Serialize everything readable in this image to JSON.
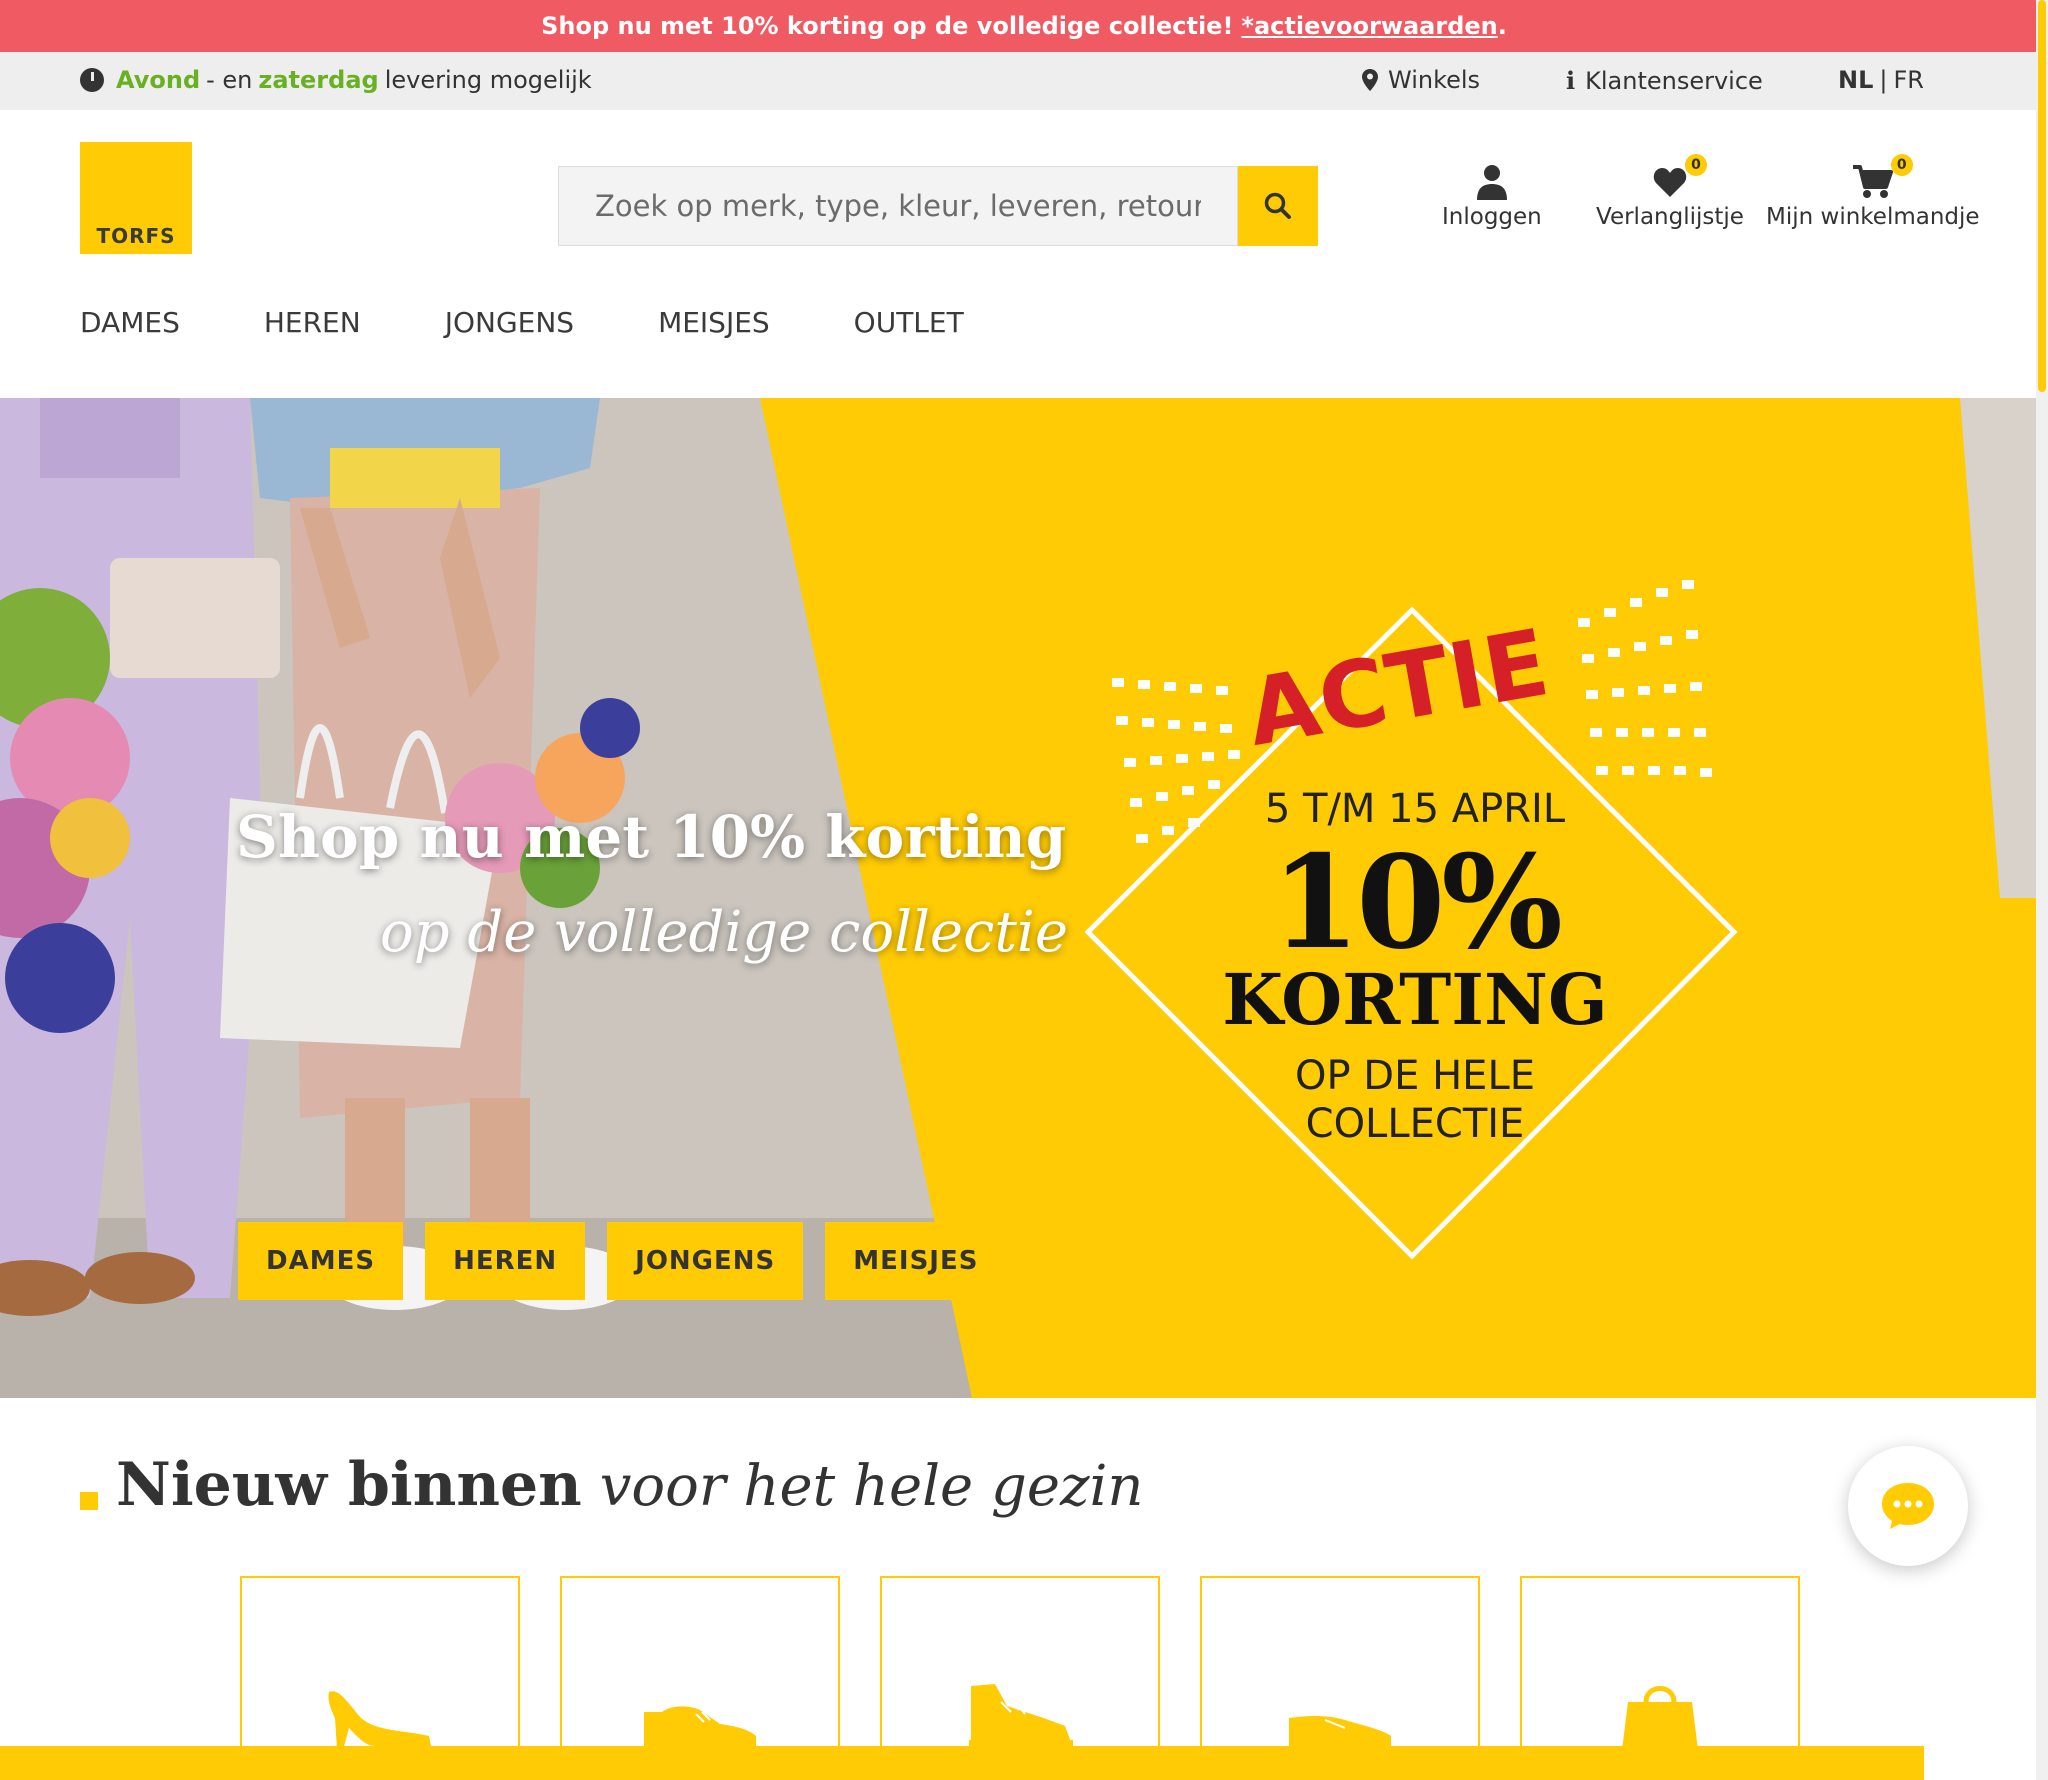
{
  "promo_bar": {
    "text": "Shop nu met 10% korting op de volledige collectie!",
    "link": "*actievoorwaarden",
    "suffix": "."
  },
  "util_bar": {
    "delivery_avond": "Avond",
    "delivery_mid": "- en",
    "delivery_zaterdag": "zaterdag",
    "delivery_rest": "levering mogelijk",
    "stores": "Winkels",
    "customer_service": "Klantenservice",
    "lang_nl": "NL",
    "lang_sep": "|",
    "lang_fr": "FR"
  },
  "header": {
    "logo": "TORFS",
    "search_placeholder": "Zoek op merk, type, kleur, leveren, retourneren...",
    "login": "Inloggen",
    "wishlist": "Verlanglijstje",
    "wishlist_count": "0",
    "cart": "Mijn winkelmandje",
    "cart_count": "0"
  },
  "nav": [
    "DAMES",
    "HEREN",
    "JONGENS",
    "MEISJES",
    "OUTLET"
  ],
  "hero": {
    "title": "Shop nu met 10% korting",
    "subtitle": "op de volledige collectie",
    "buttons": [
      "DAMES",
      "HEREN",
      "JONGENS",
      "MEISJES"
    ],
    "actie": "ACTIE",
    "dates": "5 T/M 15 APRIL",
    "percent": "10%",
    "korting": "KORTING",
    "hele_line1": "OP DE HELE",
    "hele_line2": "COLLECTIE"
  },
  "new_in": {
    "bold": "Nieuw binnen",
    "italic": "voor het hele gezin"
  },
  "category_icons": [
    "pump-icon",
    "derby-shoe-icon",
    "sneaker-icon",
    "loafer-icon",
    "bag-icon"
  ],
  "colors": {
    "accent": "#ffcb05",
    "promo": "#f05a63",
    "green": "#6ab023",
    "actie_red": "#d62027"
  }
}
